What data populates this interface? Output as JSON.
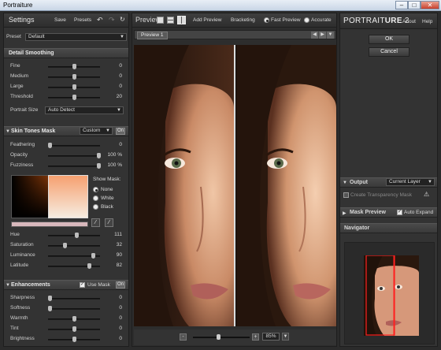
{
  "window": {
    "title": "Portraiture"
  },
  "left": {
    "header": {
      "title": "Settings",
      "save": "Save",
      "presets": "Presets"
    },
    "preset": {
      "label": "Preset",
      "value": "Default"
    },
    "detail": {
      "title": "Detail Smoothing",
      "sliders": [
        {
          "label": "Fine",
          "value": "0",
          "level": 0.5
        },
        {
          "label": "Medium",
          "value": "0",
          "level": 0.5
        },
        {
          "label": "Large",
          "value": "0",
          "level": 0.5
        },
        {
          "label": "Threshold",
          "value": "20",
          "level": 0.5
        }
      ],
      "portrait_size": {
        "label": "Portrait Size",
        "value": "Auto Detect"
      }
    },
    "skin": {
      "title": "Skin Tones Mask",
      "mode": "Custom",
      "on": "On",
      "sliders": [
        {
          "label": "Feathering",
          "value": "0",
          "unit": "",
          "level": 0.0
        },
        {
          "label": "Opacity",
          "value": "100",
          "unit": "%",
          "level": 1.0
        },
        {
          "label": "Fuzziness",
          "value": "100",
          "unit": "%",
          "level": 1.0
        }
      ],
      "show_mask": {
        "label": "Show Mask:",
        "options": [
          "None",
          "White",
          "Black"
        ],
        "selected": 0
      },
      "hsl": [
        {
          "label": "Hue",
          "value": "111",
          "level": 0.55
        },
        {
          "label": "Saturation",
          "value": "32",
          "level": 0.3
        },
        {
          "label": "Luminance",
          "value": "90",
          "level": 0.88
        },
        {
          "label": "Latitude",
          "value": "82",
          "level": 0.8
        }
      ]
    },
    "enh": {
      "title": "Enhancements",
      "use_mask": "Use Mask",
      "on": "On",
      "sliders": [
        {
          "label": "Sharpness",
          "value": "0",
          "level": 0.0
        },
        {
          "label": "Softness",
          "value": "0",
          "level": 0.0
        },
        {
          "label": "Warmth",
          "value": "0",
          "level": 0.5
        },
        {
          "label": "Tint",
          "value": "0",
          "level": 0.5
        },
        {
          "label": "Brightness",
          "value": "0",
          "level": 0.5
        }
      ]
    }
  },
  "center": {
    "preview_label": "Preview",
    "add_preview": "Add Preview",
    "bracketing": "Bracketing",
    "fast_preview": "Fast Preview",
    "accurate": "Accurate",
    "tab": "Preview 1",
    "zoom": "85%",
    "zoom_level": 0.45,
    "minus": "-",
    "plus": "+"
  },
  "right": {
    "brand_a": "PORTRAIT",
    "brand_b": "URE",
    "brand_num": "2",
    "about": "About",
    "help": "Help",
    "ok": "OK",
    "cancel": "Cancel",
    "output": {
      "title": "Output",
      "value": "Current Layer",
      "create_mask": "Create Transparency Mask"
    },
    "mask_preview": {
      "title": "Mask Preview",
      "auto_expand": "Auto Expand"
    },
    "navigator": {
      "title": "Navigator"
    }
  },
  "colors": {
    "panel": "#333333",
    "accent": "#ff2020",
    "text": "#d8d8d8"
  }
}
